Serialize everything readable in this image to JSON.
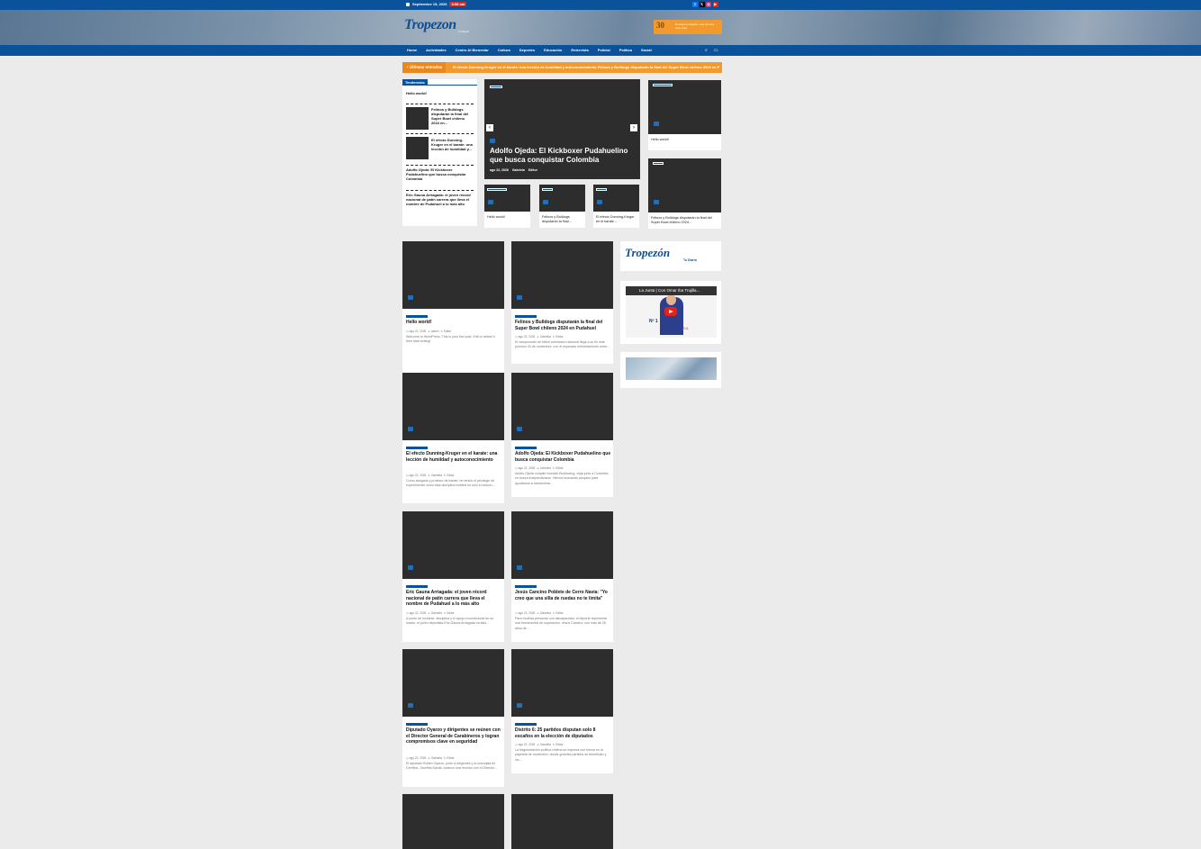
{
  "topbar": {
    "date": "Septiembre 15, 2026",
    "time": "3:58 am"
  },
  "social": [
    {
      "name": "facebook-icon",
      "glyph": "f",
      "color": "#1877f2"
    },
    {
      "name": "x-icon",
      "glyph": "𝕏",
      "color": "#000000"
    },
    {
      "name": "instagram-icon",
      "glyph": "◎",
      "color": "#c13584"
    },
    {
      "name": "youtube-icon",
      "glyph": "▶",
      "color": "#e62117"
    }
  ],
  "header": {
    "logo": "Tropezon",
    "logo_sub": "Tu Diario"
  },
  "ad_top": {
    "number": "30",
    "text": "Si usted es alguien, una primera sola. Aquí"
  },
  "nav": {
    "items": [
      "Home",
      "Actividades",
      "Centro Al Bienestar",
      "Cultura",
      "Deportes",
      "Educación",
      "Entrevista",
      "Policial",
      "Política",
      "Social"
    ]
  },
  "breaking": {
    "label": "Últimas entradas",
    "ticker": "El efecto Dunning-Kruger en el karate: una lección de humildad y autoconocimiento    Felinos y Bulldogs disputarán la final del Super Bowl chileno 2024 en Pudahuel    Adolfo Ojeda"
  },
  "trending": {
    "title": "Tendencias",
    "items": [
      "Hello world!",
      "Felinos y Bulldogs disputarán la final del Super Bowl chileno 2024 en...",
      "El efecto Dunning-Kruger en el karate: una lección de humildad y...",
      "Adolfo Ojeda: El Kickboxer Pudahuelino que busca conquistar Colombia",
      "Eric Gauna Arriagada: el joven récord nacional de patín carrera que lleva el nombre de Pudahuel a lo más alto"
    ]
  },
  "slider": {
    "title": "Adolfo Ojeda: El Kickboxer Pudahuelino que busca conquistar Colombia",
    "date": "ago 22, 2026",
    "author": "Gabriela",
    "editor": "Editor"
  },
  "slider_thumbs": [
    "Hello world!",
    "Felinos y Bulldogs disputarán la final...",
    "El efecto Dunning-Kruger en el karate..."
  ],
  "right_cards": [
    "Hello world!",
    "Felinos y Bulldogs disputarán la final del Super Bowl chileno 2024..."
  ],
  "posts": [
    {
      "title": "Hello world!",
      "date": "ago 21, 2026",
      "author": "admin",
      "editor": "Editor",
      "excerpt": "Welcome to WordPress. This is your first post. Edit or delete it, then start writing!"
    },
    {
      "title": "Felinos y Bulldogs disputarán la final del Super Bowl chileno 2024 en Pudahuel",
      "date": "ago 22, 2026",
      "author": "Gabriela",
      "editor": "Editor",
      "excerpt": "El campeonato de fútbol americano nacional llega a su fin este próximo 30 de noviembre, con el esperado enfrentamiento entre..."
    },
    {
      "title": "El efecto Dunning-Kruger en el karate: una lección de humildad y autoconocimiento",
      "date": "ago 22, 2026",
      "author": "Gabriela",
      "editor": "Editor",
      "excerpt": "Como abogado y profesor de karate, he tenido el privilegio de experimentar cómo esta disciplina moldea no solo el cuerpo,..."
    },
    {
      "title": "Adolfo Ojeda: El Kickboxer Pudahuelino que busca conquistar Colombia",
      "date": "ago 22, 2026",
      "author": "Gabriela",
      "editor": "Editor",
      "excerpt": "Adolfo Ojeda compite mundial Kickboxing, viaja junio a Colombia en busca independizarse. Hemos buscando auspicio para ayudarnos a transformar..."
    },
    {
      "title": "Eric Gauna Arriagada: el joven récord nacional de patín carrera que lleva el nombre de Pudahuel a lo más alto",
      "date": "ago 22, 2026",
      "author": "Gabriela",
      "editor": "Editor",
      "excerpt": "A punto de incluirse, disciplina y el apoyo incondicional de su madre, el joven deportista Eric Gauna Arriagada ha sido..."
    },
    {
      "title": "Jesús Cancino Poblete de Cerro Navia: \"Yo creo que una silla de ruedas no te limita\"",
      "date": "ago 22, 2026",
      "author": "Gabriela",
      "editor": "Editor",
      "excerpt": "Para muchas personas con discapacidad, el deporte representa una herramienta de superación. Jesús Cancino, con más de 26 años de..."
    },
    {
      "title": "Diputado Oyarzo y dirigentes se reúnen con el Director General de Carabineros y logran compromisos clave en seguridad",
      "date": "ago 22, 2026",
      "author": "Gabriela",
      "editor": "Editor",
      "excerpt": "El diputado Rubén Oyarzo, junto a dirigentes y la concejala de Cerrillos, Josefina Dávila, sostuvo una reunión con el Director..."
    },
    {
      "title": "Distrito 6: 25 partidos disputan solo 8 escaños en la elección de diputados",
      "date": "ago 22, 2026",
      "author": "Gabriela",
      "editor": "Editor",
      "excerpt": "La fragmentación política chilena se expresa con fuerza en la papeleta de noviembre, donde grandes partidos se benefician y los..."
    }
  ],
  "sidebar": {
    "logo": "Tropezón",
    "logo_sub": "Tu Diario",
    "video_title": "La Junta | Con Omar Iba Trujilla...",
    "video_left": "Nº 1",
    "video_right": "JUL"
  }
}
